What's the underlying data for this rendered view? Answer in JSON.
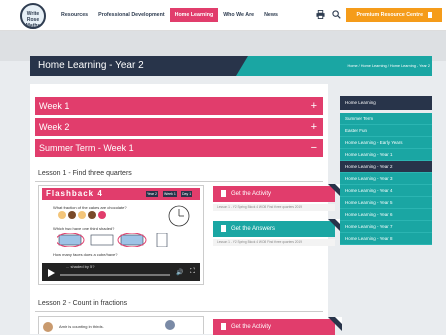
{
  "header": {
    "logo": [
      "Write",
      "Rose",
      "Maths"
    ],
    "nav": [
      "Resources",
      "Professional Development",
      "Home Learning",
      "Who We Are",
      "News"
    ],
    "active_nav": "Home Learning",
    "premium_label": "Premium Resource Centre",
    "accent_color": "#e13d6c",
    "premium_color": "#f59c1a"
  },
  "banner": {
    "title": "Home Learning - Year 2",
    "breadcrumb": "Home / Home Learning / Home Learning - Year 2"
  },
  "accordion": [
    {
      "label": "Week 1",
      "sign": "+"
    },
    {
      "label": "Week 2",
      "sign": "+"
    },
    {
      "label": "Summer Term - Week 1",
      "sign": "−"
    }
  ],
  "lessons": [
    {
      "title": "Lesson 1 - Find three quarters",
      "thumb": {
        "header": "Flashback 4",
        "tags": [
          "Year 2",
          "Week 1",
          "Day 1"
        ],
        "questions": [
          "What fraction of the cakes are chocolate?",
          "Which two have one third shaded?",
          "How many faces does a cube/have?",
          "... shaded by 5?"
        ]
      },
      "activity_label": "Get the Activity",
      "activity_sub": "Lesson 1 - Y2 Spring Block 4 WO8 Find three quarters 2019",
      "answers_label": "Get the Answers",
      "answers_sub": "Lesson 1 - Y2 Spring Block 4 WO8 Find three quarters 2019"
    },
    {
      "title": "Lesson 2 - Count in fractions",
      "thumb_text": "Amir is counting in thirds.",
      "activity_label": "Get the Activity"
    }
  ],
  "sidebar": {
    "heading": "Home Learning",
    "items": [
      "Summer Term",
      "Easter Fun",
      "Home Learning - Early Years",
      "Home Learning - Year 1",
      "Home Learning - Year 2",
      "Home Learning - Year 3",
      "Home Learning - Year 4",
      "Home Learning - Year 5",
      "Home Learning - Year 6",
      "Home Learning - Year 7",
      "Home Learning - Year 8"
    ],
    "active": "Home Learning - Year 2"
  }
}
